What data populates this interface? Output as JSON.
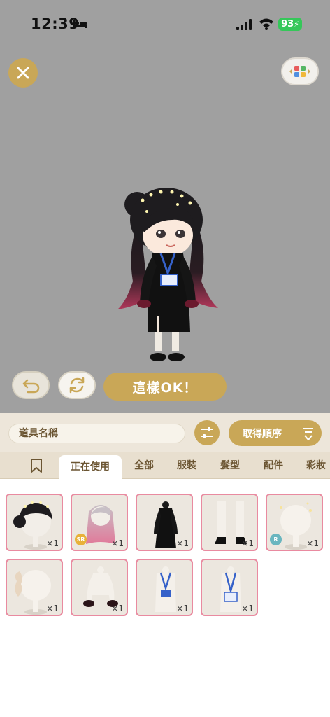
{
  "status": {
    "time": "12:39",
    "battery": "93"
  },
  "stage": {
    "ok_label": "這樣OK！"
  },
  "filter": {
    "name_field": "道具名稱",
    "sort_label": "取得順序"
  },
  "tabs": [
    {
      "label": "正在使用",
      "active": true
    },
    {
      "label": "全部",
      "active": false
    },
    {
      "label": "服裝",
      "active": false
    },
    {
      "label": "髮型",
      "active": false
    },
    {
      "label": "配件",
      "active": false
    },
    {
      "label": "彩妝",
      "active": false
    }
  ],
  "items": [
    {
      "name": "black-hair-tiara",
      "qty": "×1",
      "rarity": ""
    },
    {
      "name": "pink-gradient-hair",
      "qty": "×1",
      "rarity": "SR"
    },
    {
      "name": "black-coat-dress",
      "qty": "×1",
      "rarity": ""
    },
    {
      "name": "white-socks-heels",
      "qty": "×1",
      "rarity": ""
    },
    {
      "name": "sparkle-head-accessory",
      "qty": "×1",
      "rarity": "R"
    },
    {
      "name": "hair-bow-accessory",
      "qty": "×1",
      "rarity": ""
    },
    {
      "name": "ruffle-cuffs",
      "qty": "×1",
      "rarity": ""
    },
    {
      "name": "blue-lanyard-badge",
      "qty": "×1",
      "rarity": ""
    },
    {
      "name": "name-badge-lanyard",
      "qty": "×1",
      "rarity": ""
    }
  ],
  "colors": {
    "gold": "#c9a757",
    "pink_border": "#e98aa0",
    "stage_bg": "#a0a0a0"
  }
}
